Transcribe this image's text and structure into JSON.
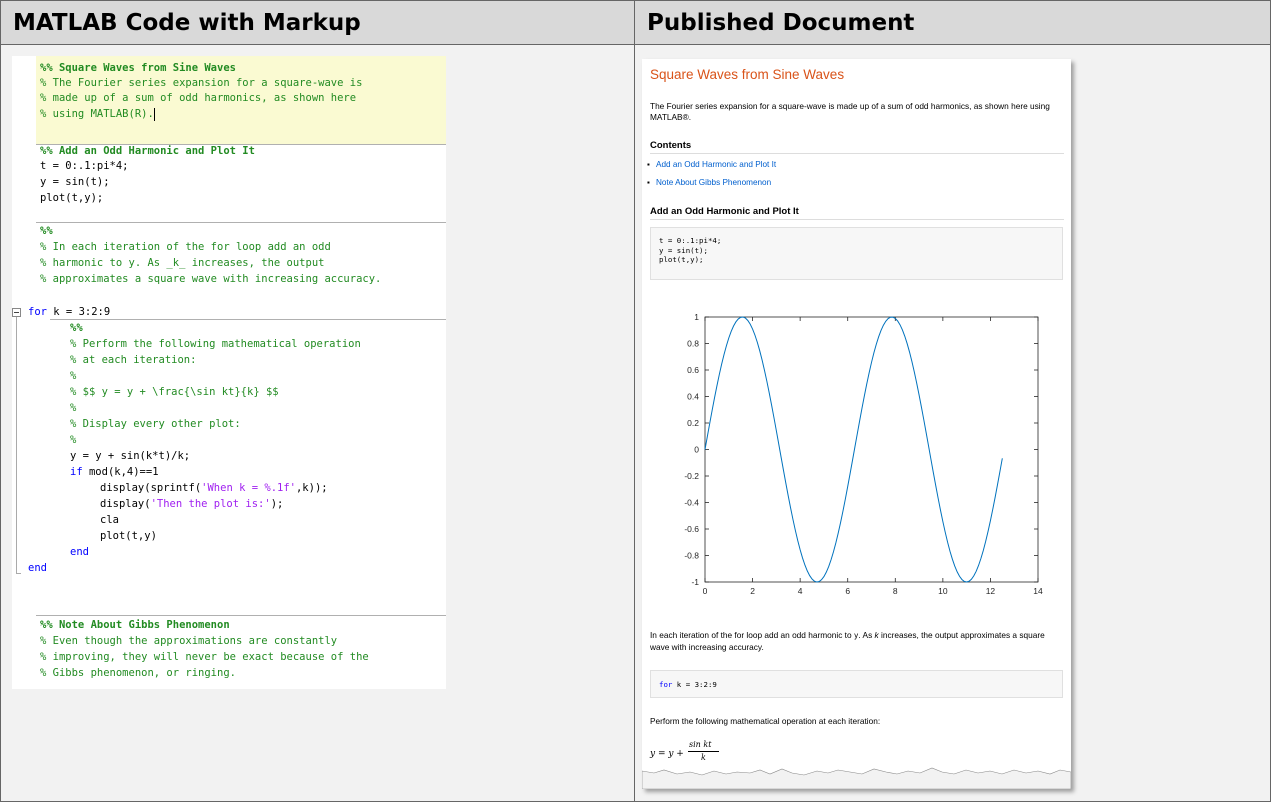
{
  "headers": {
    "left": "MATLAB Code with Markup",
    "right": "Published Document"
  },
  "editor": {
    "cell1": [
      "%% Square Waves from Sine Waves",
      "% The Fourier series expansion for a square-wave is",
      "% made up of a sum of odd harmonics, as shown here",
      "% using MATLAB(R)."
    ],
    "cell2": [
      "%% Add an Odd Harmonic and Plot It",
      "t = 0:.1:pi*4;",
      "y = sin(t);",
      "plot(t,y);"
    ],
    "cell3": [
      "%%",
      "% In each iteration of the for loop add an odd",
      "% harmonic to y. As _k_ increases, the output",
      "% approximates a square wave with increasing accuracy."
    ],
    "for_kw": "for",
    "for_rest": " k = 3:2:9",
    "loop_comments": [
      "%%",
      "% Perform the following mathematical operation",
      "% at each iteration:",
      "%",
      "% $$ y = y + \\frac{\\sin kt}{k} $$",
      "%",
      "% Display every other plot:",
      "%"
    ],
    "loop_y": "y = y + sin(k*t)/k;",
    "if_kw": "if",
    "if_rest": " mod(k,4)==1",
    "disp1_a": "display(sprintf(",
    "disp1_str": "'When k = %.1f'",
    "disp1_b": ",k));",
    "disp2_a": "display(",
    "disp2_str": "'Then the plot is:'",
    "disp2_b": ");",
    "cla": "cla",
    "plot2": "plot(t,y)",
    "end_inner": "end",
    "end_outer": "end",
    "cell4": [
      "%% Note About Gibbs Phenomenon",
      "% Even though the approximations are constantly",
      "% improving, they will never be exact because of the",
      "% Gibbs phenomenon, or ringing."
    ]
  },
  "published": {
    "title": "Square Waves from Sine Waves",
    "intro": "The Fourier series expansion for a square-wave is made up of a sum of odd harmonics, as shown here using MATLAB®.",
    "contents_heading": "Contents",
    "toc": [
      "Add an Odd Harmonic and Plot It",
      "Note About Gibbs Phenomenon"
    ],
    "section1_heading": "Add an Odd Harmonic and Plot It",
    "code1": "t = 0:.1:pi*4;\ny = sin(t);\nplot(t,y);",
    "para2_pre": "In each iteration of the for loop add an odd harmonic to ",
    "para2_y": "y",
    "para2_mid": ". As ",
    "para2_k": "k",
    "para2_post": " increases, the output approximates a square wave with increasing accuracy.",
    "code2_kw": "for",
    "code2_rest": " k = 3:2:9",
    "para3": "Perform the following mathematical operation at each iteration:",
    "eq_left": "y = y + ",
    "eq_num": "sin kt",
    "eq_den": "k"
  },
  "chart_data": {
    "type": "line",
    "title": "",
    "xlabel": "",
    "ylabel": "",
    "xlim": [
      0,
      14
    ],
    "ylim": [
      -1,
      1
    ],
    "xticks": [
      0,
      2,
      4,
      6,
      8,
      10,
      12,
      14
    ],
    "yticks": [
      -1,
      -0.8,
      -0.6,
      -0.4,
      -0.2,
      0,
      0.2,
      0.4,
      0.6,
      0.8,
      1
    ],
    "ytick_labels": [
      "-1",
      "-0.8",
      "-0.6",
      "-0.4",
      "-0.2",
      "0",
      "0.2",
      "0.4",
      "0.6",
      "0.8",
      "1"
    ],
    "series": [
      {
        "function": "y = sin(t)",
        "x_start": 0,
        "x_step": 0.1,
        "x_end": 12.5,
        "color": "#0072bd"
      }
    ]
  }
}
